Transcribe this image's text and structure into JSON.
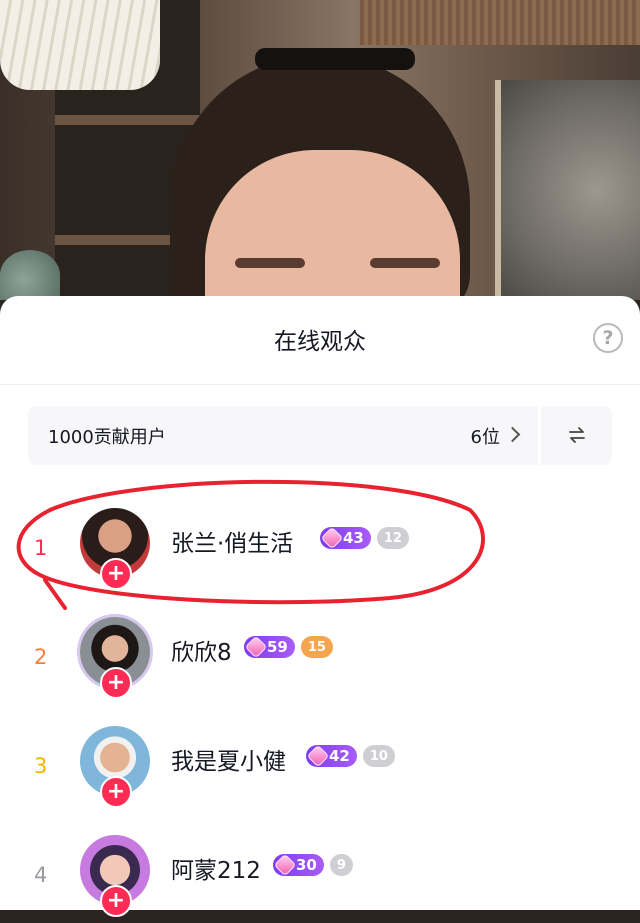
{
  "sheet": {
    "title": "在线观众",
    "help_icon": "question-circle-icon"
  },
  "contributors": {
    "label": "1000贡献用户",
    "count": "6位",
    "chevron_icon": "chevron-right-icon",
    "swap_icon": "swap-arrows-icon"
  },
  "viewers": [
    {
      "rank": "1",
      "rank_color": "#fe2c55",
      "name": "张兰·俏生活",
      "level": "43",
      "fan_level": "12",
      "fan_color": "#cfcfd3"
    },
    {
      "rank": "2",
      "rank_color": "#ff7a3a",
      "name": "欣欣8",
      "level": "59",
      "fan_level": "15",
      "fan_color": "#f5a54d"
    },
    {
      "rank": "3",
      "rank_color": "#f5b400",
      "name": "我是夏小健",
      "level": "42",
      "fan_level": "10",
      "fan_color": "#cfcfd3"
    },
    {
      "rank": "4",
      "rank_color": "#9a9aa0",
      "name": "阿蒙212",
      "level": "30",
      "fan_level": "9",
      "fan_color": "#cfcfd3"
    }
  ],
  "colors": {
    "accent": "#fe2c55",
    "annotation": "#e8232f"
  }
}
